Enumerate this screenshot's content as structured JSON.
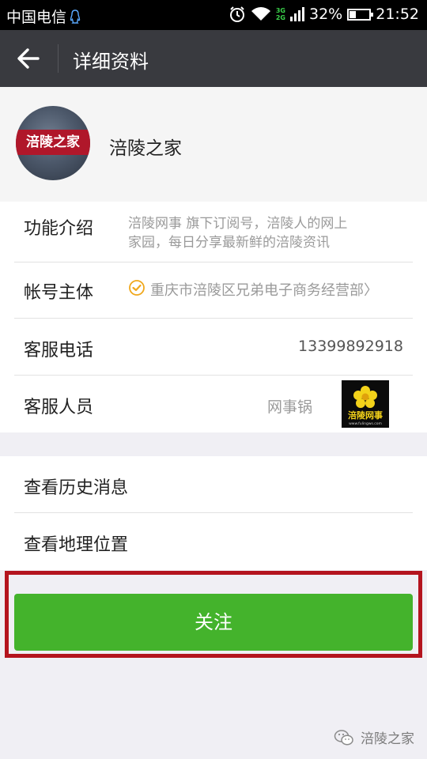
{
  "status_bar": {
    "carrier": "中国电信",
    "net_top": "3G",
    "net_bottom": "2G",
    "battery": "32%",
    "battery_level": 0.32,
    "time": "21:52"
  },
  "header": {
    "title": "详细资料"
  },
  "profile": {
    "avatar_text": "涪陵之家",
    "name": "涪陵之家"
  },
  "info": {
    "intro_label": "功能介绍",
    "intro_line1": "涪陵网事 旗下订阅号，涪陵人的网上",
    "intro_line2": "家园，每日分享最新鲜的涪陵资讯",
    "subject_label": "帐号主体",
    "subject_value": "重庆市涪陵区兄弟电子商务经营部〉",
    "phone_label": "客服电话",
    "phone_value": "13399892918",
    "staff_label": "客服人员",
    "staff_value": "网事锅",
    "staff_logo_text": "涪陵网事",
    "staff_logo_url": "www.fulingws.com"
  },
  "actions": {
    "history_label": "查看历史消息",
    "location_label": "查看地理位置"
  },
  "follow": {
    "label": "关注"
  },
  "watermark": {
    "text": "涪陵之家"
  },
  "colors": {
    "title_bar": "#393a3f",
    "follow_button": "#44b32c",
    "highlight_frame": "#b4141e",
    "verify": "#f0a81c"
  }
}
